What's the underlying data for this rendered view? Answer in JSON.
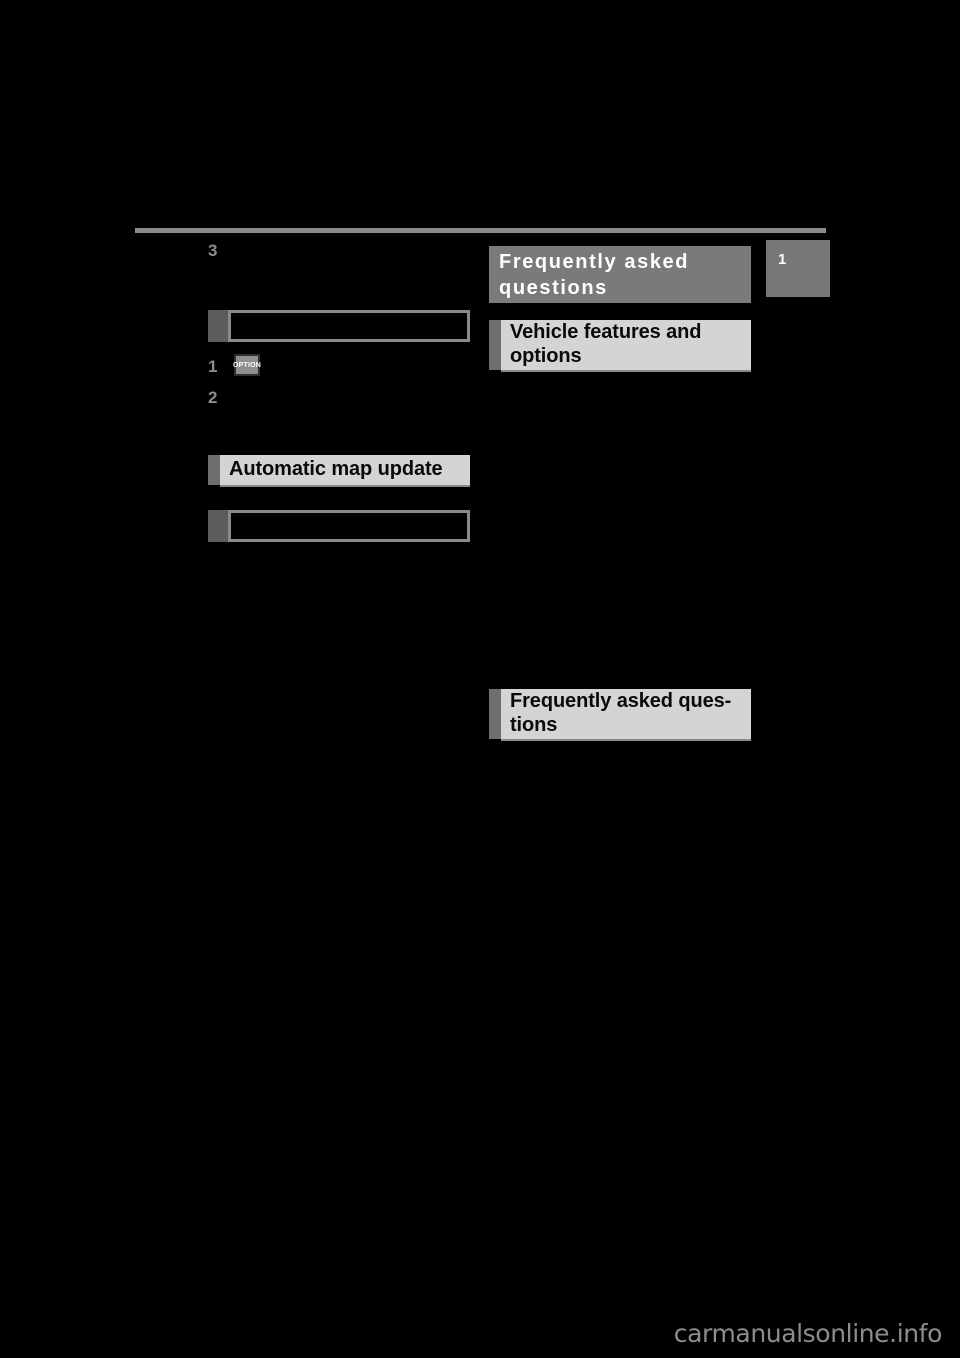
{
  "page": {
    "background_color": "#000000",
    "rule_color": "#8a8a8a"
  },
  "chapter_tab": {
    "number": "1",
    "background_color": "#777777",
    "text_color": "#ffffff"
  },
  "chapter_title": {
    "label": "Frequently asked questions",
    "background_color": "#7a7a7a",
    "text_color": "#ffffff"
  },
  "left_column": {
    "steps": [
      {
        "number": "3",
        "text": ""
      },
      {
        "number": "1",
        "text": ""
      },
      {
        "number": "2",
        "text": ""
      }
    ],
    "option_key": {
      "label": "OPTION",
      "background_color": "#8e8e8e",
      "text_color": "#ffffff"
    },
    "figures": [
      {
        "caption": ""
      },
      {
        "caption": ""
      }
    ],
    "headings": [
      {
        "label": "Automatic map update",
        "background_color": "#d4d4d4",
        "tab_color": "#6e6e6e",
        "text_color": "#0a0a0a"
      }
    ]
  },
  "right_column": {
    "headings": [
      {
        "label": "Vehicle features and options",
        "background_color": "#d4d4d4",
        "tab_color": "#6e6e6e",
        "text_color": "#0a0a0a"
      },
      {
        "label": "Frequently asked ques-tions",
        "background_color": "#d4d4d4",
        "tab_color": "#6e6e6e",
        "text_color": "#0a0a0a"
      }
    ]
  },
  "footer": {
    "watermark": "carmanualsonline.info",
    "watermark_color": "#8d8d8d"
  }
}
